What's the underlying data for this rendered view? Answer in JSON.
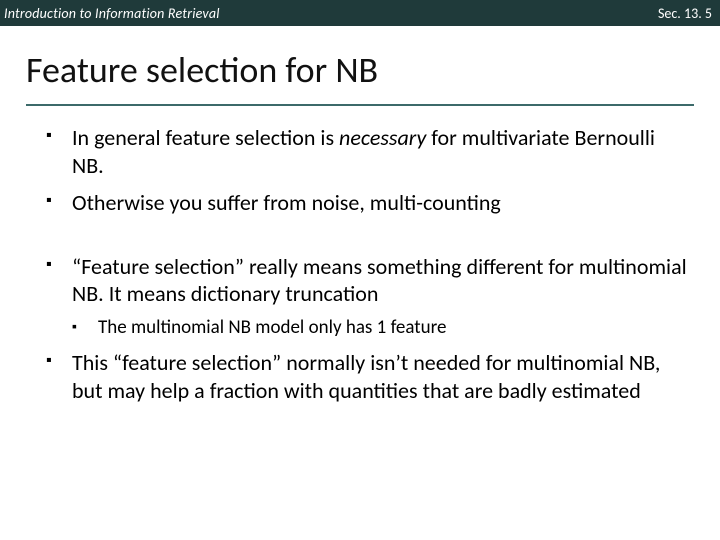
{
  "header": {
    "left": "Introduction to Information Retrieval",
    "right": "Sec. 13. 5"
  },
  "title": "Feature selection for NB",
  "bullets": {
    "b1_pre": "In general feature selection is ",
    "b1_em": "necessary",
    "b1_post": " for multivariate Bernoulli NB.",
    "b2": "Otherwise you suffer from noise, multi-counting",
    "b3": "“Feature selection” really means something different for multinomial NB.  It means dictionary truncation",
    "b3_sub": "The multinomial NB model only has 1 feature",
    "b4": "This “feature selection” normally isn’t needed for multinomial NB, but may help a fraction with quantities that are badly estimated"
  }
}
